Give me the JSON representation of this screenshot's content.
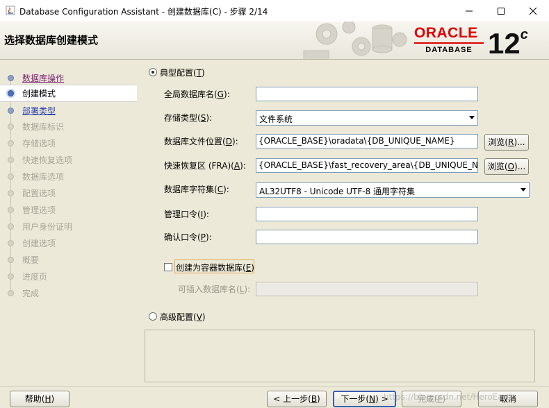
{
  "window": {
    "title": "Database Configuration Assistant - 创建数据库(C) - 步骤 2/14"
  },
  "header": {
    "page_title": "选择数据库创建模式",
    "logo": {
      "brand": "ORACLE",
      "product": "DATABASE",
      "version": "12",
      "version_suffix": "c",
      "brand_color": "#e00000"
    }
  },
  "steps": [
    {
      "label": "数据库操作",
      "state": "done"
    },
    {
      "label": "创建模式",
      "state": "current"
    },
    {
      "label": "部署类型",
      "state": "next"
    },
    {
      "label": "数据库标识",
      "state": "disabled"
    },
    {
      "label": "存储选项",
      "state": "disabled"
    },
    {
      "label": "快速恢复选项",
      "state": "disabled"
    },
    {
      "label": "数据库选项",
      "state": "disabled"
    },
    {
      "label": "配置选项",
      "state": "disabled"
    },
    {
      "label": "管理选项",
      "state": "disabled"
    },
    {
      "label": "用户身份证明",
      "state": "disabled"
    },
    {
      "label": "创建选项",
      "state": "disabled"
    },
    {
      "label": "概要",
      "state": "disabled"
    },
    {
      "label": "进度页",
      "state": "disabled"
    },
    {
      "label": "完成",
      "state": "disabled"
    }
  ],
  "form": {
    "typical": {
      "label": "典型配置",
      "mnemonic": "T",
      "checked": true
    },
    "global_db_name": {
      "label": "全局数据库名",
      "mnemonic": "G",
      "value": ""
    },
    "storage_type": {
      "label": "存储类型",
      "mnemonic": "S",
      "value": "文件系统"
    },
    "db_file_location": {
      "label": "数据库文件位置",
      "mnemonic": "D",
      "value": "{ORACLE_BASE}\\oradata\\{DB_UNIQUE_NAME}",
      "browse": "浏览",
      "browse_mnemonic": "R"
    },
    "fra": {
      "label": "快速恢复区 (FRA)",
      "mnemonic": "A",
      "value": "{ORACLE_BASE}\\fast_recovery_area\\{DB_UNIQUE_NAME}",
      "browse": "浏览",
      "browse_mnemonic": "O"
    },
    "charset": {
      "label": "数据库字符集",
      "mnemonic": "C",
      "value": "AL32UTF8 - Unicode UTF-8 通用字符集"
    },
    "admin_password": {
      "label": "管理口令",
      "mnemonic": "I",
      "value": ""
    },
    "confirm_password": {
      "label": "确认口令",
      "mnemonic": "P",
      "value": ""
    },
    "container_db": {
      "label": "创建为容器数据库",
      "mnemonic": "E",
      "checked": false
    },
    "pluggable_name": {
      "label": "可插入数据库名",
      "mnemonic": "L",
      "value": ""
    },
    "advanced": {
      "label": "高级配置",
      "mnemonic": "V",
      "checked": false
    }
  },
  "footer": {
    "help": {
      "label": "帮助",
      "mnemonic": "H"
    },
    "back": {
      "label": "< 上一步",
      "mnemonic": "B"
    },
    "next": {
      "label": "下一步",
      "mnemonic": "N",
      "suffix": " >"
    },
    "finish": {
      "label": "完成",
      "mnemonic": "F"
    },
    "cancel": {
      "label": "取消"
    }
  },
  "watermark": "https://blog.csdn.net/HeroEarth",
  "icons": [
    "java-app-icon",
    "minimize-icon",
    "maximize-icon",
    "close-icon",
    "gears-icon",
    "oracle-logo"
  ]
}
